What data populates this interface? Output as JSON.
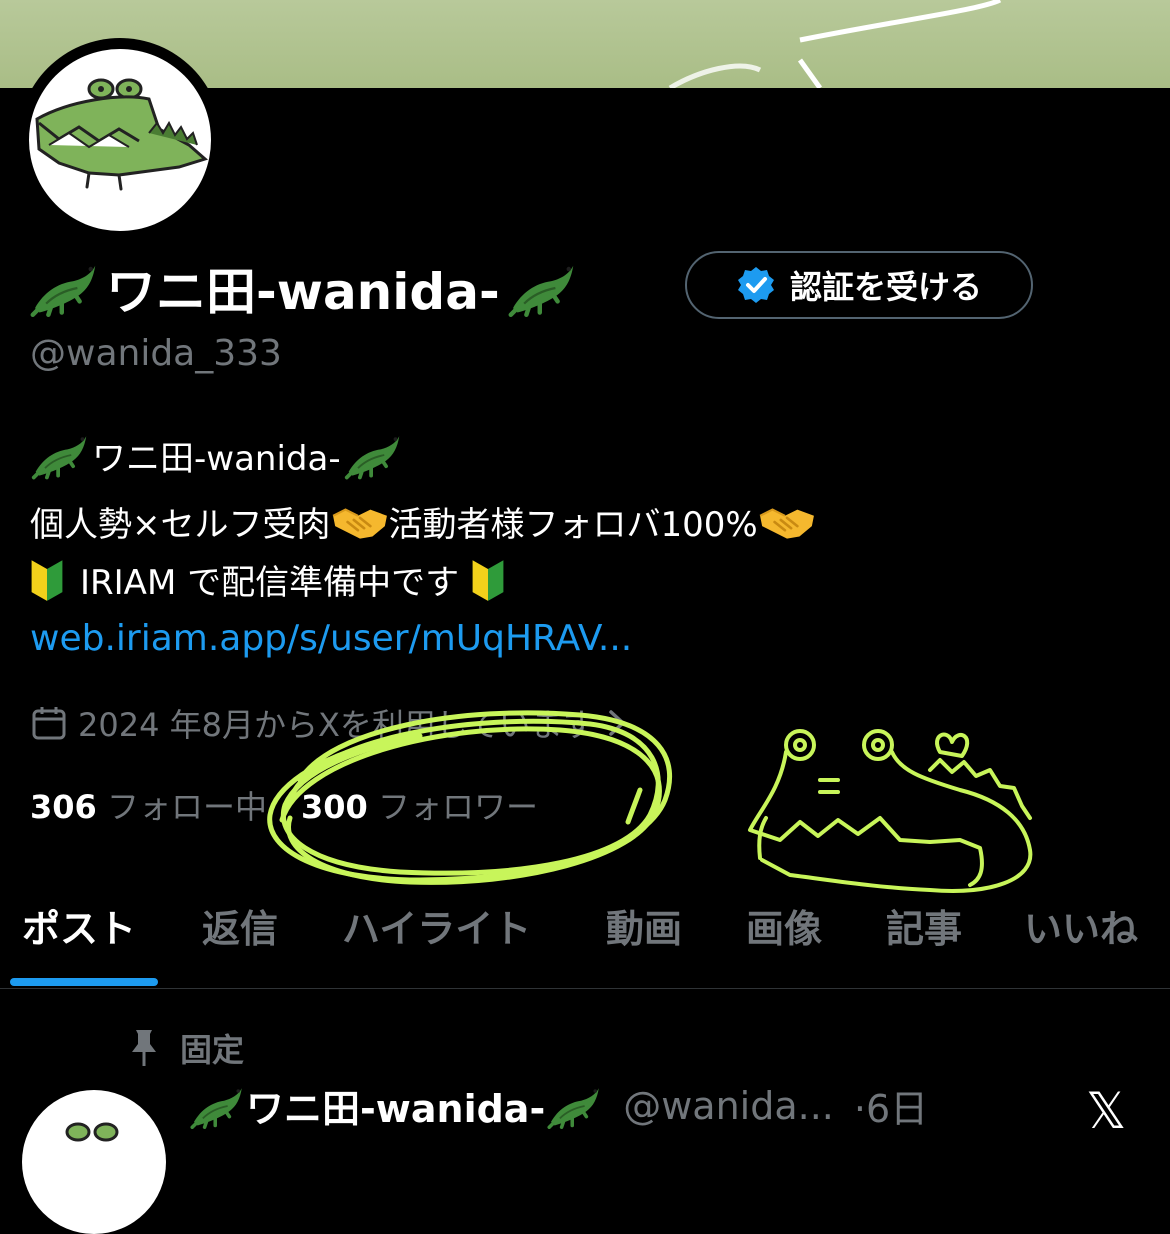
{
  "profile": {
    "display_name": "ワニ田-wanida-",
    "handle": "@wanida_333",
    "verify_button": "認証を受ける"
  },
  "bio": {
    "line1": "ワニ田-wanida-",
    "line2_a": "個人勢×セルフ受肉",
    "line2_b": "活動者様フォロバ100%",
    "line3": "IRIAM で配信準備中です",
    "link": "web.iriam.app/s/user/mUqHRAV..."
  },
  "joined": {
    "text": "2024 年8月からXを利用しています"
  },
  "stats": {
    "following_count": "306",
    "following_label": "フォロー中",
    "followers_count": "300",
    "followers_label": "フォロワー"
  },
  "tabs": [
    "ポスト",
    "返信",
    "ハイライト",
    "動画",
    "画像",
    "記事",
    "いいね"
  ],
  "active_tab": "ポスト",
  "pinned": {
    "label": "固定",
    "author_name": "ワニ田-wanida-",
    "author_handle": "@wanida...",
    "time": "·6日"
  },
  "icons": [
    "crocodile-emoji",
    "verified-badge-icon",
    "handshake-emoji",
    "beginner-mark-emoji",
    "calendar-icon",
    "chevron-right-icon",
    "pin-icon",
    "x-logo-icon"
  ],
  "colors": {
    "background": "#000000",
    "link": "#1d9bf0",
    "muted": "#71767b",
    "highlight": "#c8f55a",
    "tab_indicator": "#1d9bf0"
  }
}
